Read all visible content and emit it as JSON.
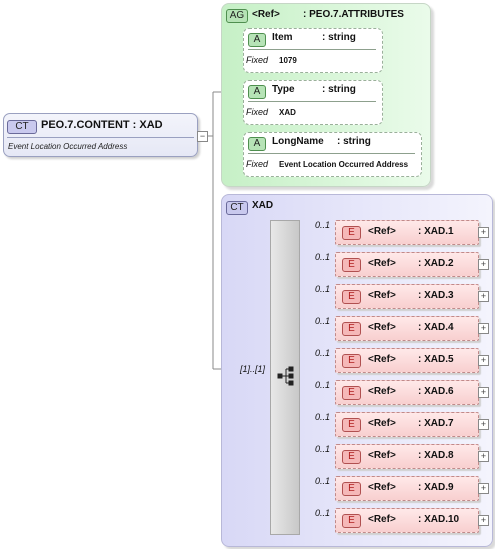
{
  "root": {
    "badge": "CT",
    "title": "PEO.7.CONTENT : XAD",
    "description": "Event Location Occurred Address"
  },
  "attribute_group": {
    "badge": "AG",
    "ref": "<Ref>",
    "name": ": PEO.7.ATTRIBUTES",
    "attributes": [
      {
        "badge": "A",
        "name": "Item",
        "type": ": string",
        "fixed_label": "Fixed",
        "fixed_value": "1079"
      },
      {
        "badge": "A",
        "name": "Type",
        "type": ": string",
        "fixed_label": "Fixed",
        "fixed_value": "XAD"
      },
      {
        "badge": "A",
        "name": "LongName",
        "type": ": string",
        "fixed_label": "Fixed",
        "fixed_value": "Event Location Occurred Address"
      }
    ]
  },
  "complex_type": {
    "badge": "CT",
    "name": "XAD",
    "cardinality": "[1]..[1]",
    "elements": [
      {
        "occurs": "0..1",
        "badge": "E",
        "ref": "<Ref>",
        "name": ": XAD.1"
      },
      {
        "occurs": "0..1",
        "badge": "E",
        "ref": "<Ref>",
        "name": ": XAD.2"
      },
      {
        "occurs": "0..1",
        "badge": "E",
        "ref": "<Ref>",
        "name": ": XAD.3"
      },
      {
        "occurs": "0..1",
        "badge": "E",
        "ref": "<Ref>",
        "name": ": XAD.4"
      },
      {
        "occurs": "0..1",
        "badge": "E",
        "ref": "<Ref>",
        "name": ": XAD.5"
      },
      {
        "occurs": "0..1",
        "badge": "E",
        "ref": "<Ref>",
        "name": ": XAD.6"
      },
      {
        "occurs": "0..1",
        "badge": "E",
        "ref": "<Ref>",
        "name": ": XAD.7"
      },
      {
        "occurs": "0..1",
        "badge": "E",
        "ref": "<Ref>",
        "name": ": XAD.8"
      },
      {
        "occurs": "0..1",
        "badge": "E",
        "ref": "<Ref>",
        "name": ": XAD.9"
      },
      {
        "occurs": "0..1",
        "badge": "E",
        "ref": "<Ref>",
        "name": ": XAD.10"
      }
    ]
  }
}
